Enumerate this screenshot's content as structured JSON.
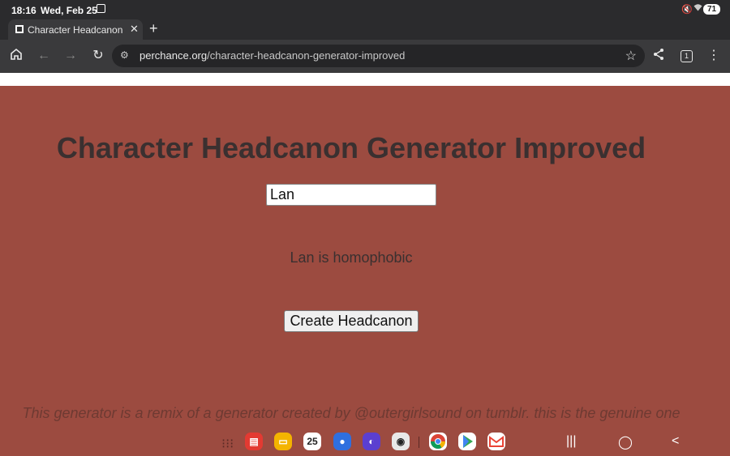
{
  "status_bar": {
    "time": "18:16",
    "date": "Wed, Feb 25",
    "battery": "71"
  },
  "tab": {
    "title": "Character Headcanon Generator Improved",
    "close": "✕",
    "new_tab": "+"
  },
  "toolbar": {
    "url_host": "perchance.org",
    "url_path": "/character-headcanon-generator-improved",
    "tab_count": "1"
  },
  "page": {
    "heading": "Character Headcanon Generator Improved",
    "name_value": "Lan",
    "result": "Lan is homophobic",
    "button_label": "Create Headcanon",
    "credit": "This generator is a remix of a generator created by @outergirlsound on tumblr. this is the genuine one"
  },
  "dock": {
    "calendar_day": "25"
  },
  "colors": {
    "page_background": "#9c4b40",
    "text_dark": "#3a3030",
    "credit_text": "#6e3a32",
    "browser_chrome": "#3a3a3c"
  }
}
